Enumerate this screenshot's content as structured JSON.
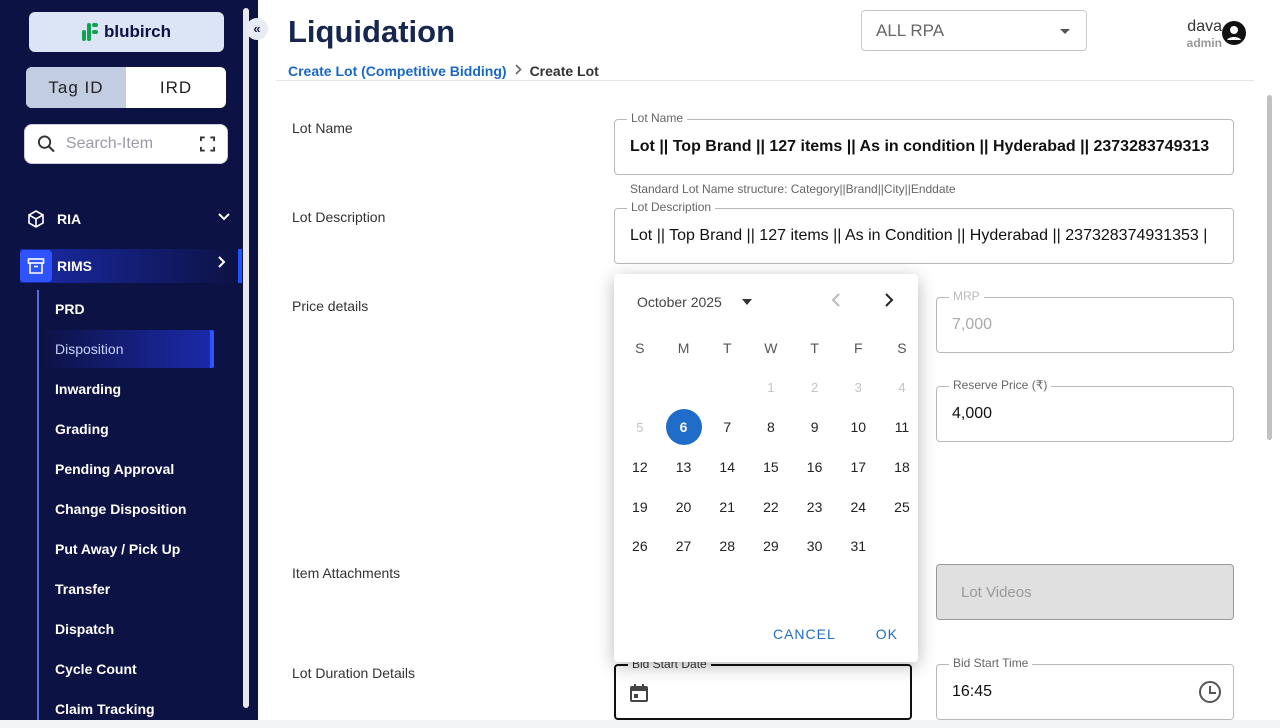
{
  "sidebar": {
    "logo_text": "blubirch",
    "toggle": {
      "options": [
        "Tag ID",
        "IRD"
      ],
      "selected": "Tag ID"
    },
    "search_placeholder": "Search-Item",
    "sections": [
      {
        "label": "RIA",
        "icon": "cube-icon"
      },
      {
        "label": "RIMS",
        "icon": "archive-box-icon",
        "active": true
      }
    ],
    "rims_items": [
      "PRD",
      "Disposition",
      "Inwarding",
      "Grading",
      "Pending Approval",
      "Change Disposition",
      "Put Away / Pick Up",
      "Transfer",
      "Dispatch",
      "Cycle Count",
      "Claim Tracking"
    ],
    "active_item": "Disposition"
  },
  "header": {
    "title": "Liquidation",
    "rpa_select": "ALL RPA",
    "user_name": "dava",
    "user_role": "admin"
  },
  "breadcrumb": {
    "link": "Create Lot (Competitive Bidding)",
    "current": "Create Lot"
  },
  "form": {
    "lot_name": {
      "section": "Lot Name",
      "label": "Lot Name",
      "value": "Lot || Top Brand || 127 items || As in condition || Hyderabad || 2373283749313",
      "helper": "Standard Lot Name structure: Category||Brand||City||Enddate"
    },
    "lot_description": {
      "section": "Lot Description",
      "label": "Lot Description",
      "value": "Lot || Top Brand || 127 items || As in Condition || Hyderabad || 237328374931353 |"
    },
    "price": {
      "section": "Price details",
      "mrp_label": "MRP",
      "mrp_value": "7,000",
      "reserve_label": "Reserve Price (₹)",
      "reserve_value": "4,000"
    },
    "attachments": {
      "section": "Item Attachments",
      "videos_label": "Lot Videos"
    },
    "duration": {
      "section": "Lot Duration Details",
      "bid_start_date_label": "Bid Start Date",
      "bid_start_time_label": "Bid Start Time",
      "bid_start_time_value": "16:45"
    }
  },
  "datepicker": {
    "month_label": "October 2025",
    "weekdays": [
      "S",
      "M",
      "T",
      "W",
      "T",
      "F",
      "S"
    ],
    "leading_blanks": 3,
    "days_in_month": 31,
    "disabled_through": 5,
    "selected_day": 6,
    "cancel_label": "CANCEL",
    "ok_label": "OK"
  },
  "colors": {
    "sidebar_bg": "#0d1244",
    "accent": "#1f6dc9",
    "brand_green": "#12a150",
    "title": "#16264d"
  }
}
